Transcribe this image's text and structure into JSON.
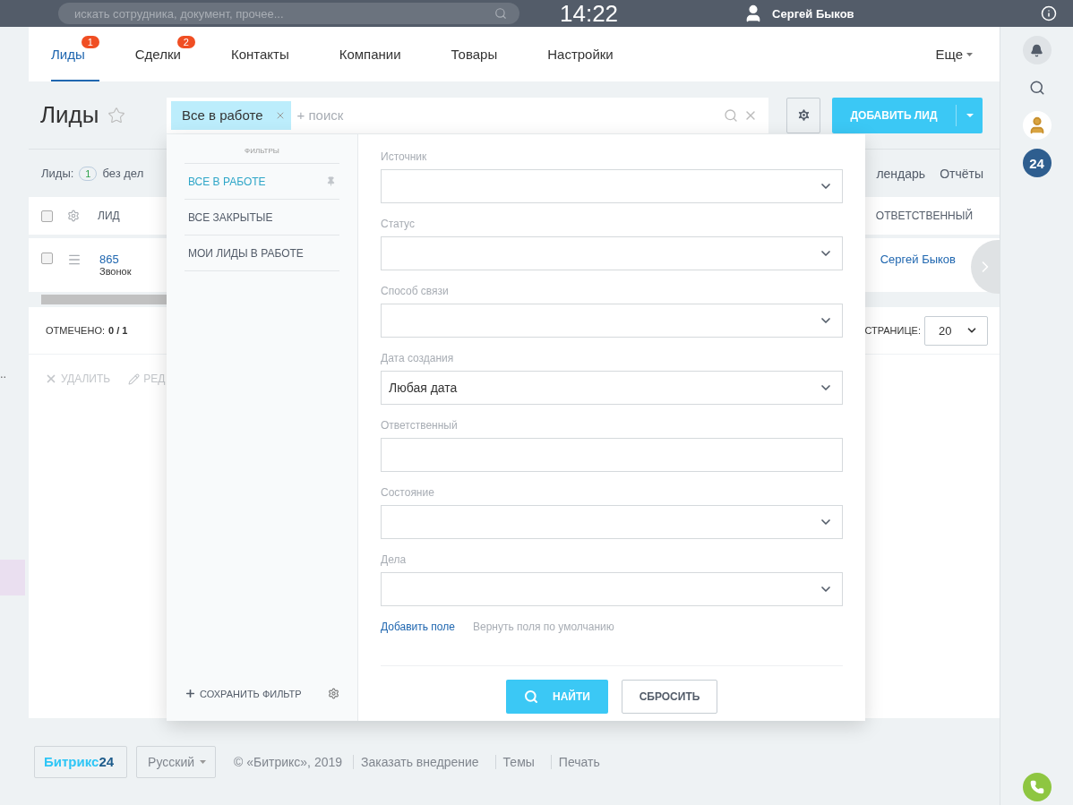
{
  "header": {
    "search_placeholder": "искать сотрудника, документ, прочее...",
    "time": "14:22",
    "user": "Сергей Быков"
  },
  "tabs": [
    {
      "label": "Лиды",
      "badge": "1",
      "selected": true
    },
    {
      "label": "Сделки",
      "badge": "2",
      "selected": false
    },
    {
      "label": "Контакты",
      "selected": false
    },
    {
      "label": "Компании",
      "selected": false
    },
    {
      "label": "Товары",
      "selected": false
    },
    {
      "label": "Настройки",
      "selected": false
    }
  ],
  "more": "Еще",
  "title": "Лиды",
  "filter": {
    "chip": "Все в работе",
    "placeholder": "+ поиск"
  },
  "add_button": "ДОБАВИТЬ ЛИД",
  "counter": {
    "label": "Лиды:",
    "count": "1",
    "text": "без дел"
  },
  "view_links": [
    "лендарь",
    "Отчёты"
  ],
  "grid": {
    "header_checked": false,
    "columns": [
      "ЛИД",
      "ОТВЕТСТВЕННЫЙ"
    ],
    "rows": [
      {
        "id": "865",
        "subtitle": "Звонок",
        "responsible": "Сергей Быков",
        "checked": false
      }
    ]
  },
  "selected_count": {
    "label": "ОТМЕЧЕНО:",
    "value": "0 / 1"
  },
  "page_size": {
    "label": "СТРАНИЦЕ:",
    "value": "20"
  },
  "actions": [
    {
      "kind": "delete",
      "label": "УДАЛИТЬ"
    },
    {
      "kind": "edit",
      "label": "РЕД"
    }
  ],
  "side_dots": "..",
  "sidebar": {
    "badge": "24"
  },
  "popup": {
    "heading": "ФИЛЬТРЫ",
    "presets": [
      {
        "label": "ВСЕ В РАБОТЕ",
        "selected": true,
        "pinned": true
      },
      {
        "label": "ВСЕ ЗАКРЫТЫЕ",
        "selected": false,
        "pinned": false
      },
      {
        "label": "МОИ ЛИДЫ В РАБОТЕ",
        "selected": false,
        "pinned": false
      }
    ],
    "save": "СОХРАНИТЬ ФИЛЬТР",
    "fields": [
      {
        "label": "Источник",
        "kind": "select"
      },
      {
        "label": "Статус",
        "kind": "select"
      },
      {
        "label": "Способ связи",
        "kind": "select"
      },
      {
        "label": "Дата создания",
        "kind": "select",
        "value": "Любая дата"
      },
      {
        "label": "Ответственный",
        "kind": "text"
      },
      {
        "label": "Состояние",
        "kind": "select"
      },
      {
        "label": "Дела",
        "kind": "select"
      }
    ],
    "add_field": "Добавить поле",
    "reset_fields": "Вернуть поля по умолчанию",
    "find": "НАЙТИ",
    "reset": "СБРОСИТЬ"
  },
  "footer": {
    "logo": "Битрикс",
    "logo_number": "24",
    "language": "Русский",
    "copyright": "© «Битрикс», 2019",
    "links": [
      "Заказать внедрение",
      "Темы",
      "Печать"
    ]
  }
}
